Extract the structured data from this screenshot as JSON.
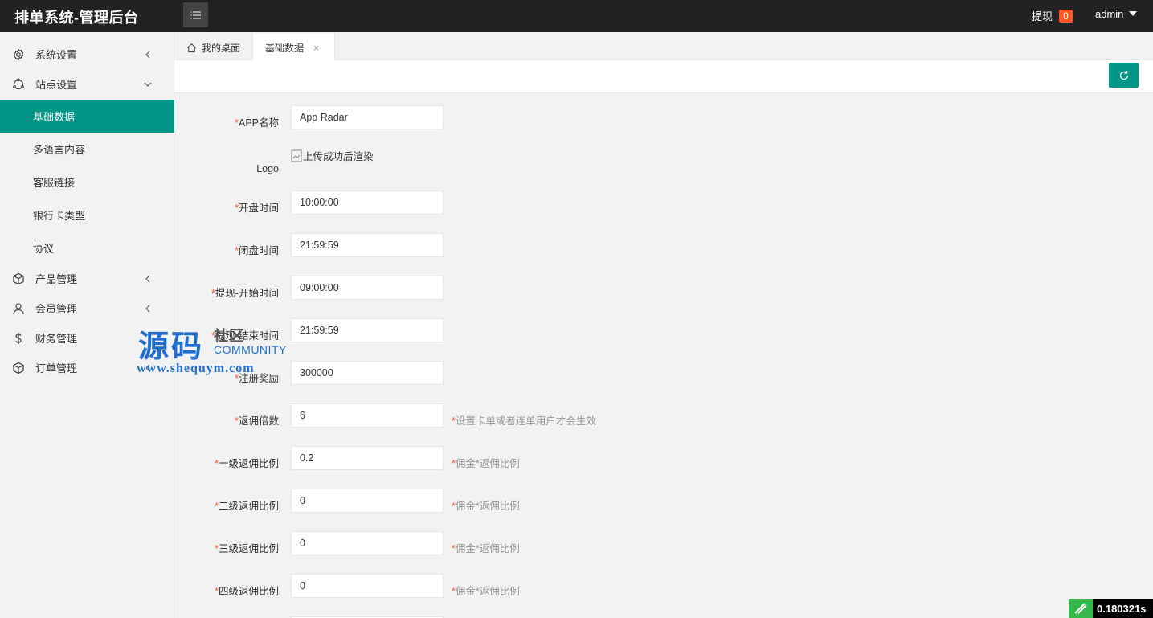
{
  "header": {
    "app_title": "排单系统-管理后台",
    "withdraw_label": "提现",
    "withdraw_count": "0",
    "user": "admin"
  },
  "sidebar": {
    "items": [
      {
        "label": "系统设置",
        "icon": "gear-icon",
        "expanded": false
      },
      {
        "label": "站点设置",
        "icon": "site-icon",
        "expanded": true
      },
      {
        "label": "产品管理",
        "icon": "cube-icon",
        "expanded": false
      },
      {
        "label": "会员管理",
        "icon": "user-icon",
        "expanded": false
      },
      {
        "label": "财务管理",
        "icon": "dollar-icon"
      },
      {
        "label": "订单管理",
        "icon": "cube-icon",
        "expanded": false
      }
    ],
    "sub_items": [
      {
        "label": "基础数据",
        "active": true
      },
      {
        "label": "多语言内容"
      },
      {
        "label": "客服链接"
      },
      {
        "label": "银行卡类型"
      },
      {
        "label": "协议"
      }
    ]
  },
  "tabs": {
    "home_label": "我的桌面",
    "active_label": "基础数据",
    "close_glyph": "×"
  },
  "form": {
    "fields": [
      {
        "label": "APP名称",
        "required": true,
        "value": "App Radar"
      },
      {
        "label": "Logo",
        "required": false,
        "image_alt": "上传成功后渲染"
      },
      {
        "label": "开盘时间",
        "required": true,
        "value": "10:00:00"
      },
      {
        "label": "闭盘时间",
        "required": true,
        "value": "21:59:59"
      },
      {
        "label": "提现-开始时间",
        "required": true,
        "value": "09:00:00"
      },
      {
        "label": "提现-结束时间",
        "required": true,
        "value": "21:59:59"
      },
      {
        "label": "注册奖励",
        "required": true,
        "value": "300000"
      },
      {
        "label": "返佣倍数",
        "required": true,
        "value": "6",
        "hint": "设置卡单或者连单用户才会生效"
      },
      {
        "label": "一级返佣比例",
        "required": true,
        "value": "0.2",
        "hint": "佣金*返佣比例"
      },
      {
        "label": "二级返佣比例",
        "required": true,
        "value": "0",
        "hint": "佣金*返佣比例"
      },
      {
        "label": "三级返佣比例",
        "required": true,
        "value": "0",
        "hint": "佣金*返佣比例"
      },
      {
        "label": "四级返佣比例",
        "required": true,
        "value": "0",
        "hint": "佣金*返佣比例"
      }
    ]
  },
  "watermark": {
    "title": "源码",
    "title_small": "社区",
    "english": "COMMUNITY",
    "url": "www.shequym.com"
  },
  "timer": {
    "value": "0.180321s"
  },
  "colors": {
    "header_bg": "#222222",
    "accent": "#009688",
    "badge": "#ff5722",
    "required": "#ff5722"
  }
}
